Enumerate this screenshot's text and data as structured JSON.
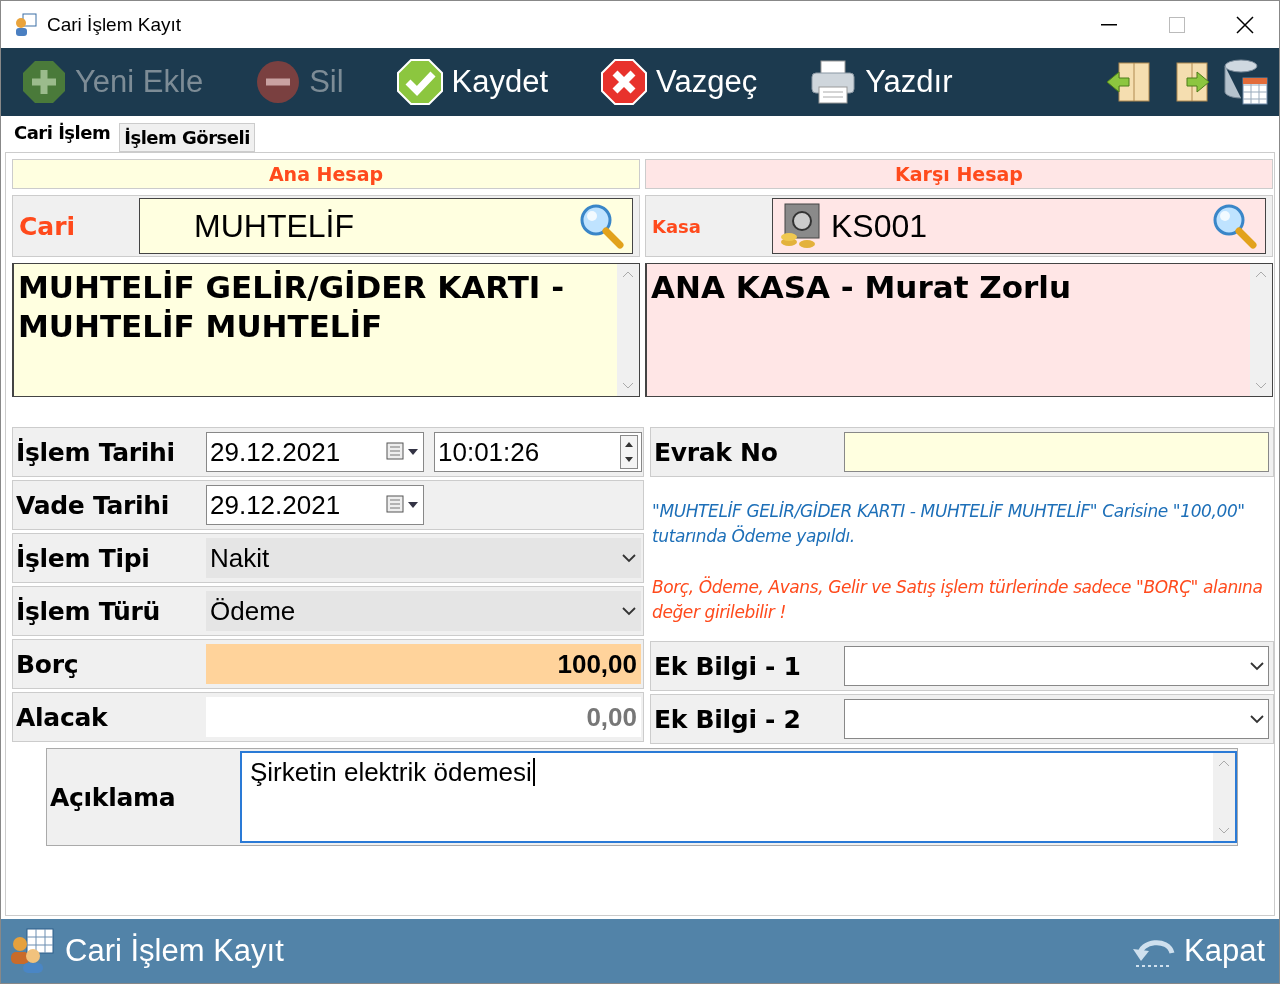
{
  "window": {
    "title": "Cari İşlem Kayıt"
  },
  "toolbar": {
    "buttons": [
      {
        "kind": "add",
        "label": "Yeni Ekle",
        "disabled": true
      },
      {
        "kind": "delete",
        "label": "Sil",
        "disabled": true
      },
      {
        "kind": "save",
        "label": "Kaydet",
        "disabled": false
      },
      {
        "kind": "cancel",
        "label": "Vazgeç",
        "disabled": false
      },
      {
        "kind": "print",
        "label": "Yazdır",
        "disabled": false
      }
    ]
  },
  "tabs": [
    {
      "label": "Cari İşlem",
      "selected": true
    },
    {
      "label": "İşlem Görseli",
      "selected": false
    }
  ],
  "accounts": [
    {
      "kind": "main",
      "header": "Ana Hesap",
      "label": "Cari",
      "code": "MUHTELİF",
      "description": "MUHTELİF GELİR/GİDER KARTI - MUHTELİF MUHTELİF"
    },
    {
      "kind": "counter",
      "header": "Karşı Hesap",
      "label": "Kasa",
      "code": "KS001",
      "description": "ANA KASA - Murat Zorlu"
    }
  ],
  "fields": [
    {
      "kind": "datetime",
      "label": "İşlem Tarihi",
      "value": "29.12.2021",
      "time": "10:01:26"
    },
    {
      "kind": "date",
      "label": "Vade Tarihi",
      "value": "29.12.2021"
    },
    {
      "kind": "select",
      "label": "İşlem Tipi",
      "value": "Nakit"
    },
    {
      "kind": "select",
      "label": "İşlem Türü",
      "value": "Ödeme"
    },
    {
      "kind": "amount",
      "label": "Borç",
      "value": "100,00",
      "disabled": false
    },
    {
      "kind": "amount",
      "label": "Alacak",
      "value": "0,00",
      "disabled": true
    }
  ],
  "evrak_no": {
    "label": "Evrak No"
  },
  "messages": [
    {
      "kind": "info",
      "text": "\"MUHTELİF GELİR/GİDER KARTI - MUHTELİF MUHTELİF\" Carisine \"100,00\" tutarında Ödeme yapıldı."
    },
    {
      "kind": "warning",
      "text": "Borç, Ödeme, Avans, Gelir ve Satış işlem türlerinde sadece \"BORÇ\" alanına değer girilebilir !"
    }
  ],
  "extra_fields": [
    {
      "label": "Ek Bilgi - 1"
    },
    {
      "label": "Ek Bilgi - 2"
    }
  ],
  "note": {
    "label": "Açıklama",
    "value": "Şirketin elektrik ödemesi"
  },
  "footer": {
    "title": "Cari İşlem Kayıt",
    "close_label": "Kapat"
  }
}
